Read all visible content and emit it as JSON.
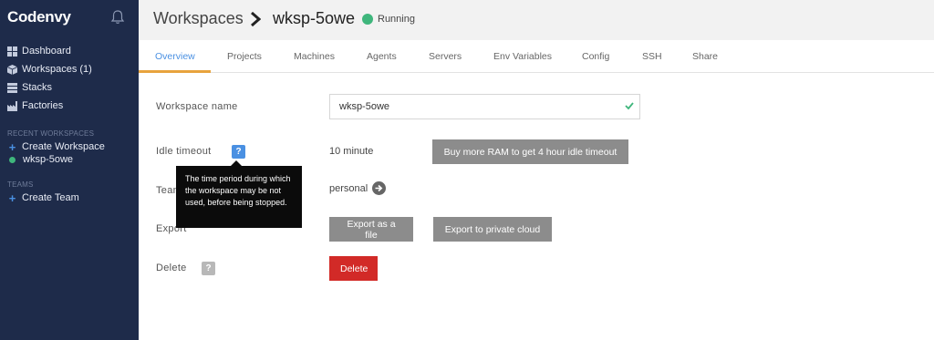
{
  "sidebar": {
    "brand": "Codenvy",
    "nav": [
      {
        "label": "Dashboard",
        "icon": "dashboard-icon"
      },
      {
        "label": "Workspaces (1)",
        "icon": "workspaces-icon"
      },
      {
        "label": "Stacks",
        "icon": "stacks-icon"
      },
      {
        "label": "Factories",
        "icon": "factories-icon"
      }
    ],
    "recent_label": "RECENT WORKSPACES",
    "create_workspace": "Create Workspace",
    "recent_workspace": "wksp-5owe",
    "teams_label": "TEAMS",
    "create_team": "Create Team"
  },
  "header": {
    "root": "Workspaces",
    "workspace": "wksp-5owe",
    "status": "Running"
  },
  "tabs": [
    {
      "label": "Overview",
      "active": true
    },
    {
      "label": "Projects"
    },
    {
      "label": "Machines"
    },
    {
      "label": "Agents"
    },
    {
      "label": "Servers"
    },
    {
      "label": "Env Variables"
    },
    {
      "label": "Config"
    },
    {
      "label": "SSH"
    },
    {
      "label": "Share"
    }
  ],
  "form": {
    "name_label": "Workspace name",
    "name_value": "wksp-5owe",
    "idle_label": "Idle timeout",
    "idle_value": "10 minute",
    "idle_button": "Buy more RAM to get 4 hour idle timeout",
    "tooltip": "The time period during which the workspace may be not used, before being stopped.",
    "team_label": "Team",
    "team_value": "personal",
    "export_label": "Export",
    "export_file": "Export as a file",
    "export_cloud": "Export to private cloud",
    "delete_label": "Delete",
    "delete_button": "Delete",
    "help_glyph": "?"
  },
  "colors": {
    "sidebar_bg": "#1e2b4a",
    "accent_blue": "#4a90e2",
    "tab_underline": "#e8a33d",
    "running_green": "#3fb67c",
    "delete_red": "#d22a27"
  }
}
